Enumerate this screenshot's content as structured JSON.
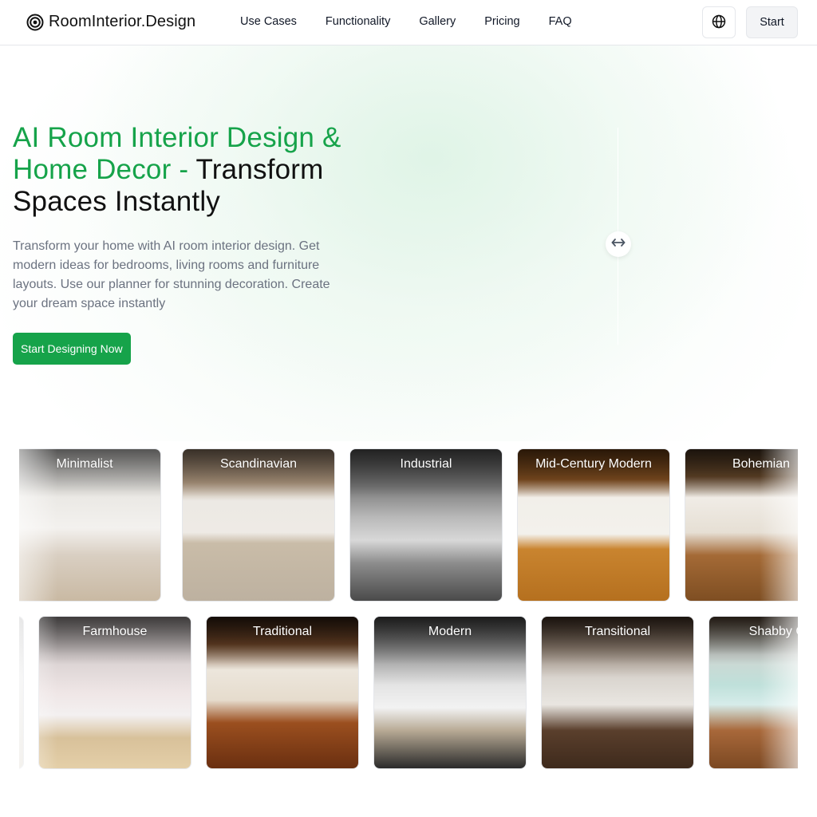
{
  "header": {
    "logo_text": "RoomInterior.Design",
    "logo_icon": "target-rings-icon",
    "nav": [
      {
        "label": "Use Cases"
      },
      {
        "label": "Functionality"
      },
      {
        "label": "Gallery"
      },
      {
        "label": "Pricing"
      },
      {
        "label": "FAQ"
      }
    ],
    "language_icon": "globe-icon",
    "start_label": "Start"
  },
  "hero": {
    "title_accent": "AI Room Interior Design & Home Decor - ",
    "title_rest": "Transform Spaces Instantly",
    "description": "Transform your home with AI room interior design. Get modern ideas for bedrooms, living rooms and furniture layouts. Use our planner for stunning decoration. Create your dream space instantly",
    "cta_label": "Start Designing Now",
    "compare_handle_icon": "left-right-arrows-icon"
  },
  "colors": {
    "accent": "#16a34a",
    "text": "#111827",
    "muted": "#6b7280"
  },
  "gallery": {
    "row1": [
      {
        "label": "Minimalist"
      },
      {
        "label": "Scandinavian"
      },
      {
        "label": "Industrial"
      },
      {
        "label": "Mid-Century Modern"
      },
      {
        "label": "Bohemian"
      }
    ],
    "row2": [
      {
        "label": ""
      },
      {
        "label": "Farmhouse"
      },
      {
        "label": "Traditional"
      },
      {
        "label": "Modern"
      },
      {
        "label": "Transitional"
      },
      {
        "label": "Shabby Chic"
      }
    ]
  }
}
